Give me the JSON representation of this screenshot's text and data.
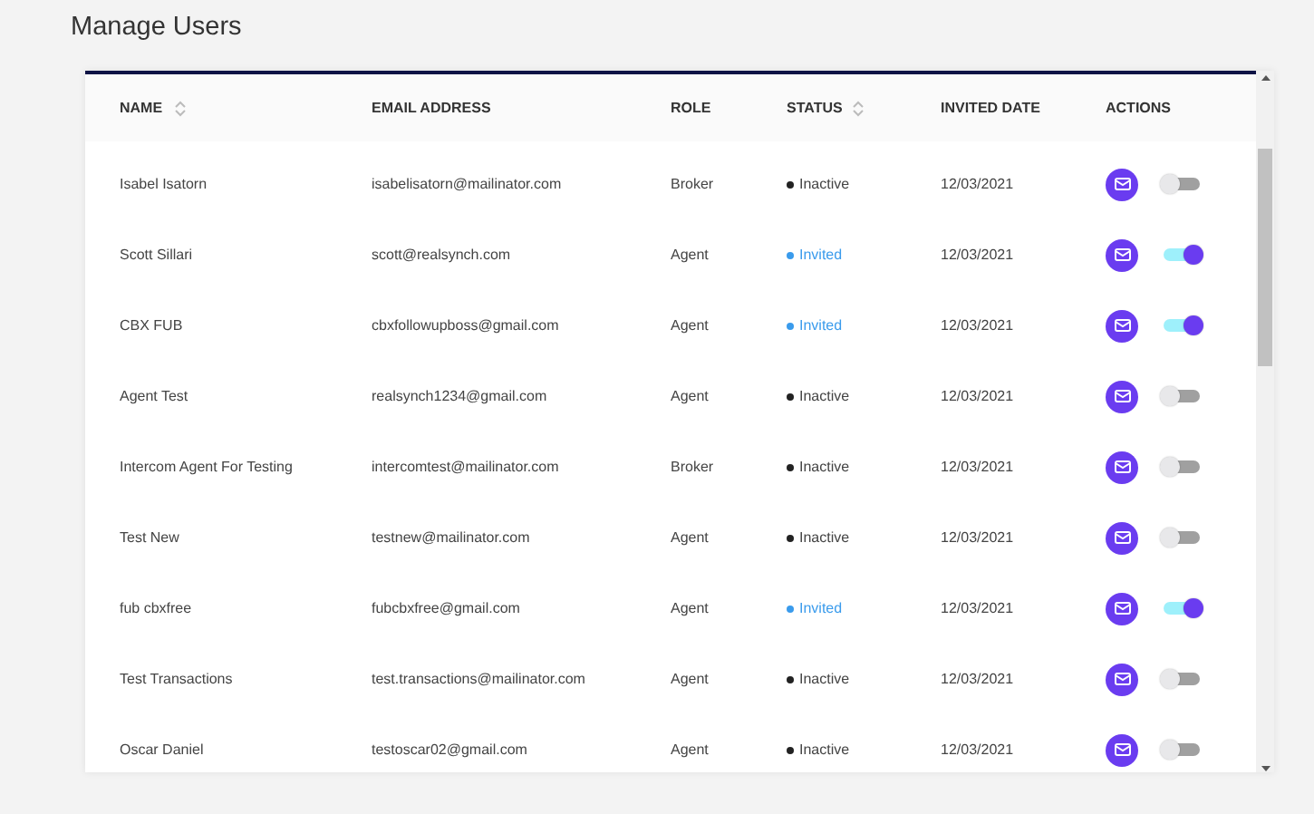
{
  "title": "Manage Users",
  "columns": [
    {
      "label": "NAME",
      "sortable": true
    },
    {
      "label": "EMAIL ADDRESS",
      "sortable": false
    },
    {
      "label": "ROLE",
      "sortable": false
    },
    {
      "label": "STATUS",
      "sortable": true
    },
    {
      "label": "INVITED DATE",
      "sortable": false
    },
    {
      "label": "ACTIONS",
      "sortable": false
    }
  ],
  "rows": [
    {
      "name": "Isabel Isatorn",
      "email": "isabelisatorn@mailinator.com",
      "role": "Broker",
      "status": {
        "text": "Inactive",
        "kind": "inactive"
      },
      "date": "12/03/2021",
      "on": false
    },
    {
      "name": "Scott Sillari",
      "email": "scott@realsynch.com",
      "role": "Agent",
      "status": {
        "text": "Invited",
        "kind": "invited"
      },
      "date": "12/03/2021",
      "on": true
    },
    {
      "name": "CBX FUB",
      "email": "cbxfollowupboss@gmail.com",
      "role": "Agent",
      "status": {
        "text": "Invited",
        "kind": "invited"
      },
      "date": "12/03/2021",
      "on": true
    },
    {
      "name": "Agent Test",
      "email": "realsynch1234@gmail.com",
      "role": "Agent",
      "status": {
        "text": "Inactive",
        "kind": "inactive"
      },
      "date": "12/03/2021",
      "on": false
    },
    {
      "name": "Intercom Agent For Testing",
      "email": "intercomtest@mailinator.com",
      "role": "Broker",
      "status": {
        "text": "Inactive",
        "kind": "inactive"
      },
      "date": "12/03/2021",
      "on": false
    },
    {
      "name": "Test New",
      "email": "testnew@mailinator.com",
      "role": "Agent",
      "status": {
        "text": "Inactive",
        "kind": "inactive"
      },
      "date": "12/03/2021",
      "on": false
    },
    {
      "name": "fub cbxfree",
      "email": "fubcbxfree@gmail.com",
      "role": "Agent",
      "status": {
        "text": "Invited",
        "kind": "invited"
      },
      "date": "12/03/2021",
      "on": true
    },
    {
      "name": "Test Transactions",
      "email": "test.transactions@mailinator.com",
      "role": "Agent",
      "status": {
        "text": "Inactive",
        "kind": "inactive"
      },
      "date": "12/03/2021",
      "on": false
    },
    {
      "name": "Oscar Daniel",
      "email": "testoscar02@gmail.com",
      "role": "Agent",
      "status": {
        "text": "Inactive",
        "kind": "inactive"
      },
      "date": "12/03/2021",
      "on": false
    }
  ]
}
